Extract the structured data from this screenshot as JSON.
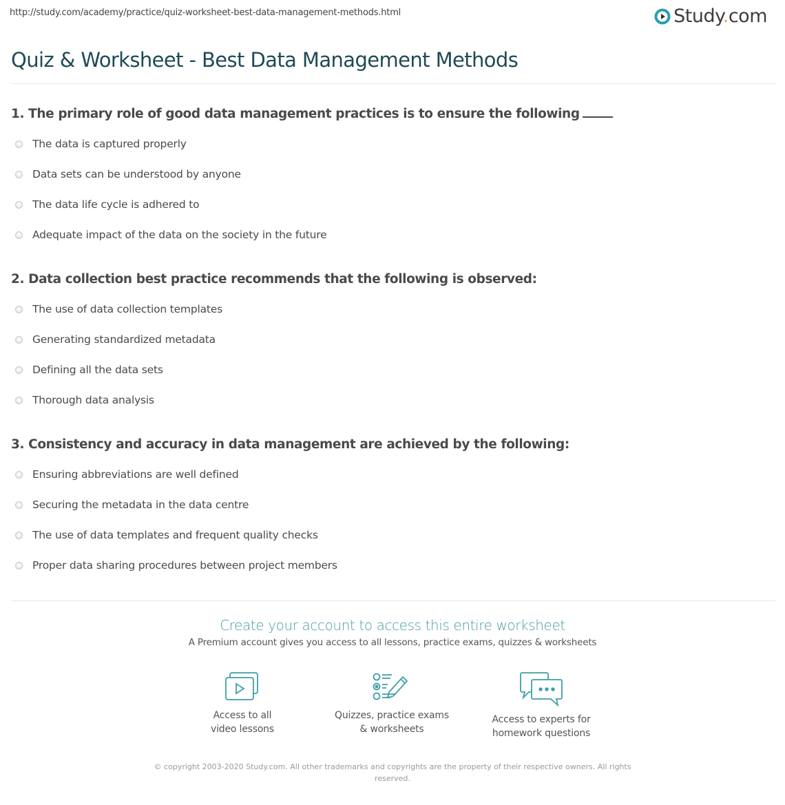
{
  "header": {
    "url": "http://study.com/academy/practice/quiz-worksheet-best-data-management-methods.html",
    "logo": {
      "icon": "play-circle-icon",
      "name": "Study",
      "dot": ".",
      "suffix": "com"
    }
  },
  "page_title": "Quiz & Worksheet - Best Data Management Methods",
  "questions": [
    {
      "text": "1. The primary role of good data management practices is to ensure the following",
      "has_blank": true,
      "options": [
        "The data is captured properly",
        "Data sets can be understood by anyone",
        "The data life cycle is adhered to",
        "Adequate impact of the data on the society in the future"
      ]
    },
    {
      "text": "2. Data collection best practice recommends that the following is observed:",
      "has_blank": false,
      "options": [
        "The use of data collection templates",
        "Generating standardized metadata",
        "Defining all the data sets",
        "Thorough data analysis"
      ]
    },
    {
      "text": "3. Consistency and accuracy in data management are achieved by the following:",
      "has_blank": false,
      "options": [
        "Ensuring abbreviations are well defined",
        "Securing the metadata in the data centre",
        "The use of data templates and frequent quality checks",
        "Proper data sharing procedures between project members"
      ]
    }
  ],
  "cta": {
    "title": "Create your account to access this entire worksheet",
    "subtitle": "A Premium account gives you access to all lessons, practice exams, quizzes & worksheets",
    "features": [
      {
        "icon": "video-lessons-icon",
        "line1": "Access to all",
        "line2": "video lessons"
      },
      {
        "icon": "quiz-checklist-icon",
        "line1": "Quizzes, practice exams",
        "line2": "& worksheets"
      },
      {
        "icon": "chat-bubbles-icon",
        "line1": "Access to experts for",
        "line2": "homework questions"
      }
    ]
  },
  "footer": {
    "copyright": "© copyright 2003-2020 Study.com. All other trademarks and copyrights are the property of their respective owners. All rights reserved."
  },
  "colors": {
    "title": "#1f4a56",
    "accent": "#4a9ca3",
    "logo_icon": "#2a9fb0",
    "logo_dot": "#f29b38",
    "icon_stroke": "#3e9fa6"
  }
}
